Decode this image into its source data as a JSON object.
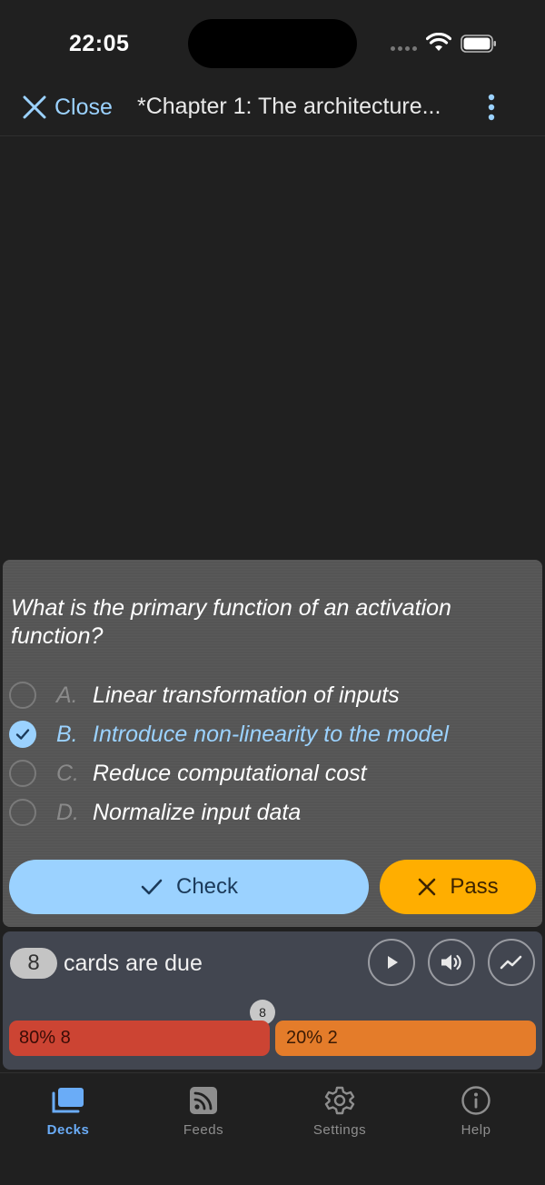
{
  "status_bar": {
    "time": "22:05"
  },
  "nav": {
    "close_label": "Close",
    "title": "*Chapter 1: The architecture..."
  },
  "quiz": {
    "question": "What is the primary function of an activation function?",
    "options": [
      {
        "letter": "A.",
        "text": "Linear transformation of inputs",
        "selected": false
      },
      {
        "letter": "B.",
        "text": "Introduce non-linearity to the model",
        "selected": true
      },
      {
        "letter": "C.",
        "text": "Reduce computational cost",
        "selected": false
      },
      {
        "letter": "D.",
        "text": "Normalize input data",
        "selected": false
      }
    ],
    "check_label": "Check",
    "pass_label": "Pass"
  },
  "due": {
    "count": "8",
    "text": "cards are due",
    "badge": "8",
    "bar_red_label": "80% 8",
    "bar_orange_label": "20% 2"
  },
  "tabs": [
    {
      "label": "Decks",
      "icon": "decks-icon",
      "active": true
    },
    {
      "label": "Feeds",
      "icon": "rss-icon",
      "active": false
    },
    {
      "label": "Settings",
      "icon": "gear-icon",
      "active": false
    },
    {
      "label": "Help",
      "icon": "info-icon",
      "active": false
    }
  ],
  "colors": {
    "accent": "#9bd2ff",
    "pass": "#ffae00",
    "bar_red": "#cc4433",
    "bar_orange": "#e47c2a",
    "tab_active": "#6aacf7"
  }
}
